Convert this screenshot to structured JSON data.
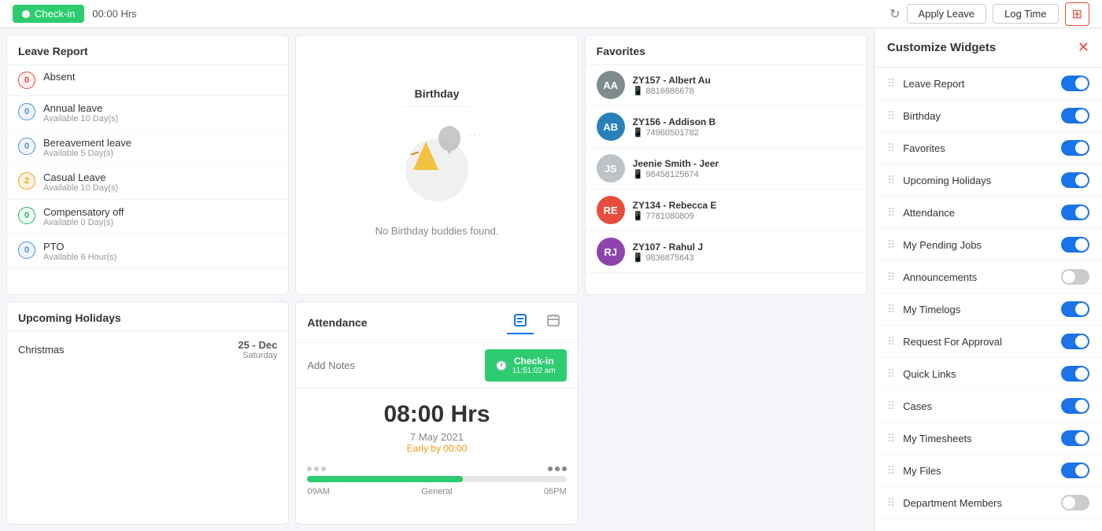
{
  "topbar": {
    "checkin_label": "Check-in",
    "time": "00:00 Hrs",
    "apply_leave_label": "Apply Leave",
    "log_time_label": "Log Time"
  },
  "leave_report": {
    "title": "Leave Report",
    "items": [
      {
        "label": "Absent",
        "count": "0",
        "badge": "red",
        "avail": ""
      },
      {
        "label": "Annual leave",
        "count": "0",
        "badge": "blue",
        "avail": "Available 10 Day(s)"
      },
      {
        "label": "Bereavement leave",
        "count": "0",
        "badge": "blue",
        "avail": "Available 5 Day(s)"
      },
      {
        "label": "Casual Leave",
        "count": "2",
        "badge": "orange",
        "avail": "Available 10 Day(s)"
      },
      {
        "label": "Compensatory off",
        "count": "0",
        "badge": "green",
        "avail": "Available 0 Day(s)"
      },
      {
        "label": "PTO",
        "count": "0",
        "badge": "blue",
        "avail": "Available 6 Hour(s)"
      }
    ]
  },
  "upcoming_holidays": {
    "title": "Upcoming Holidays",
    "items": [
      {
        "name": "Christmas",
        "date": "25 - Dec",
        "weekday": "Saturday"
      }
    ]
  },
  "birthday": {
    "title": "Birthday",
    "empty_text": "No Birthday buddies found."
  },
  "attendance": {
    "title": "Attendance",
    "notes_placeholder": "Add Notes",
    "checkin_label": "Check-in",
    "checkin_time": "11:51:02 am",
    "hours": "08:00 Hrs",
    "date": "7 May 2021",
    "early": "Early by 00:00",
    "time_start": "09AM",
    "time_label": "General",
    "time_end": "06PM"
  },
  "favorites": {
    "title": "Favorites",
    "items": [
      {
        "id": "ZY157",
        "name": "Albert Au",
        "phone": "8816686678",
        "initials": "AA",
        "color": "#7f8c8d"
      },
      {
        "id": "ZY156",
        "name": "Addison B",
        "phone": "74960501782",
        "initials": "AB",
        "color": "#2980b9"
      },
      {
        "id": "",
        "name": "Jeenie Smith - Jeer",
        "phone": "98458125674",
        "initials": "JS",
        "color": "#bdc3c7"
      },
      {
        "id": "ZY134",
        "name": "Rebecca E",
        "phone": "7781080809",
        "initials": "RE",
        "color": "#e74c3c"
      },
      {
        "id": "ZY107",
        "name": "Rahul J",
        "phone": "9836875643",
        "initials": "RJ",
        "color": "#8e44ad"
      }
    ]
  },
  "customize_widgets": {
    "title": "Customize Widgets",
    "items": [
      {
        "label": "Leave Report",
        "on": true
      },
      {
        "label": "Birthday",
        "on": true
      },
      {
        "label": "Favorites",
        "on": true
      },
      {
        "label": "Upcoming Holidays",
        "on": true
      },
      {
        "label": "Attendance",
        "on": true
      },
      {
        "label": "My Pending Jobs",
        "on": true
      },
      {
        "label": "Announcements",
        "on": false
      },
      {
        "label": "My Timelogs",
        "on": true
      },
      {
        "label": "Request For Approval",
        "on": true
      },
      {
        "label": "Quick Links",
        "on": true
      },
      {
        "label": "Cases",
        "on": true
      },
      {
        "label": "My Timesheets",
        "on": true
      },
      {
        "label": "My Files",
        "on": true
      },
      {
        "label": "Department Members",
        "on": false
      }
    ]
  }
}
